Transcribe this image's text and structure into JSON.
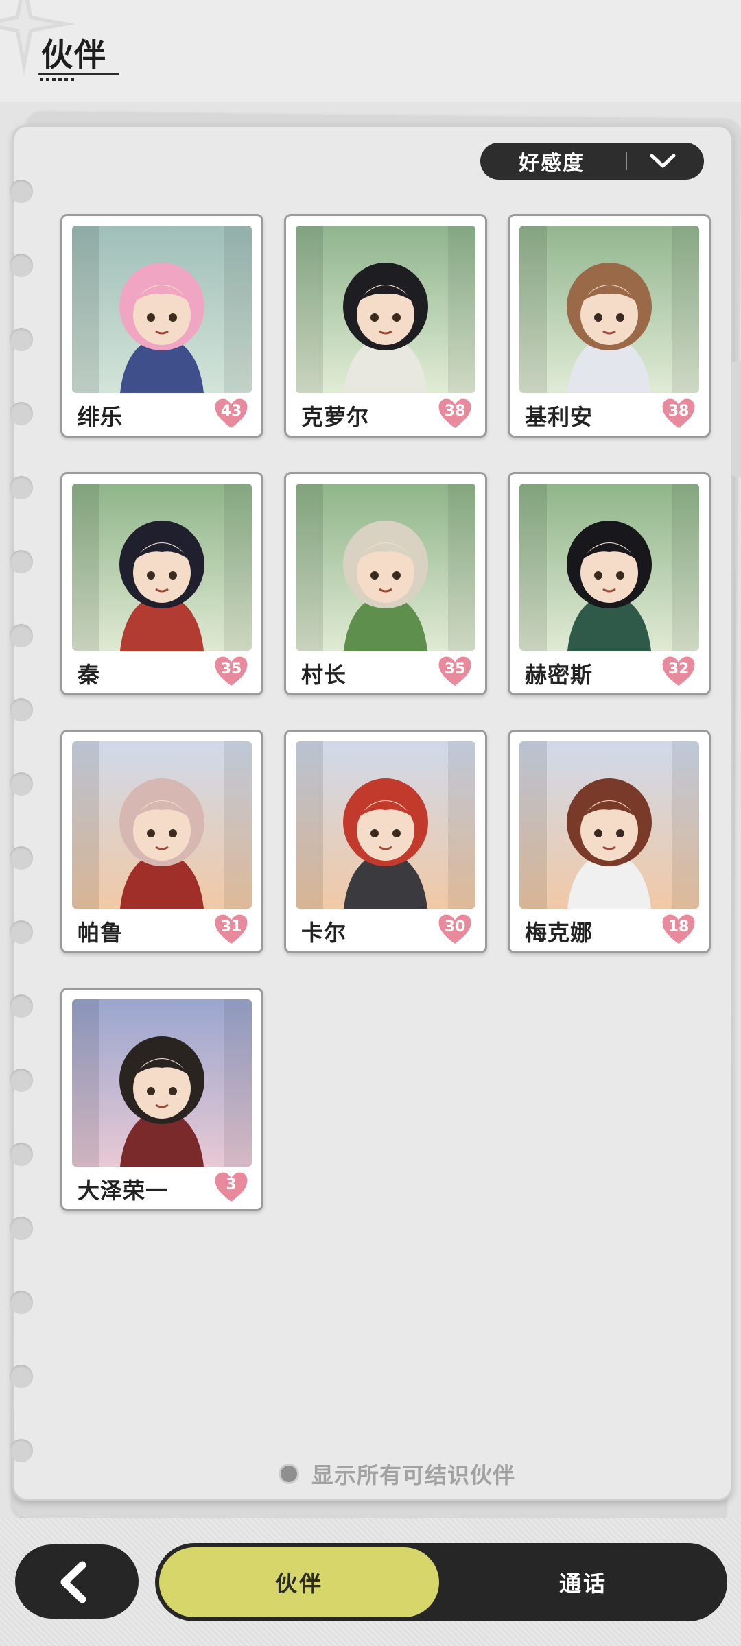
{
  "header": {
    "title": "伙伴"
  },
  "sort": {
    "label": "好感度",
    "icon": "chevron-down-icon"
  },
  "partners": [
    {
      "name": "绯乐",
      "affection": "43",
      "portrait": "pink-haired-girl-portrait",
      "bg_top": "#9fbfb8",
      "bg_bottom": "#d3e4d9",
      "hair": "#f0a6c2",
      "outfit": "#3f4f8c"
    },
    {
      "name": "克萝尔",
      "affection": "38",
      "portrait": "black-cat-witch-portrait",
      "bg_top": "#8fb58e",
      "bg_bottom": "#e1ecd5",
      "hair": "#1e1e22",
      "outfit": "#e8e8e0"
    },
    {
      "name": "基利安",
      "affection": "38",
      "portrait": "rabbit-eared-boy-portrait",
      "bg_top": "#93b68f",
      "bg_bottom": "#e0ebd6",
      "hair": "#9a6a48",
      "outfit": "#e4e6ee"
    },
    {
      "name": "秦",
      "affection": "35",
      "portrait": "horned-girl-portrait",
      "bg_top": "#8fb58a",
      "bg_bottom": "#dfe9d2",
      "hair": "#1f1f2e",
      "outfit": "#b23b32"
    },
    {
      "name": "村长",
      "affection": "35",
      "portrait": "village-chief-portrait",
      "bg_top": "#8fb58a",
      "bg_bottom": "#e0ead4",
      "hair": "#d9d2c2",
      "outfit": "#5f8f4c"
    },
    {
      "name": "赫密斯",
      "affection": "32",
      "portrait": "fox-eared-scholar-portrait",
      "bg_top": "#8fb58a",
      "bg_bottom": "#e0ead4",
      "hair": "#18181c",
      "outfit": "#2f5a4a"
    },
    {
      "name": "帕鲁",
      "affection": "31",
      "portrait": "horned-warrior-portrait",
      "bg_top": "#cfd9ea",
      "bg_bottom": "#f1c9a6",
      "hair": "#d7b7b2",
      "outfit": "#a02f2a"
    },
    {
      "name": "卡尔",
      "affection": "30",
      "portrait": "red-haired-hammer-portrait",
      "bg_top": "#cfd9ea",
      "bg_bottom": "#f1c9a6",
      "hair": "#c23a2c",
      "outfit": "#3b3b3f"
    },
    {
      "name": "梅克娜",
      "affection": "18",
      "portrait": "goggles-girl-portrait",
      "bg_top": "#cfd9ea",
      "bg_bottom": "#f1c9a6",
      "hair": "#7a3a2a",
      "outfit": "#f0f0f0"
    },
    {
      "name": "大泽荣一",
      "affection": "3",
      "portrait": "kimono-boy-portrait",
      "bg_top": "#9aa6cf",
      "bg_bottom": "#e8c9d4",
      "hair": "#2a2420",
      "outfit": "#7a2a2a"
    }
  ],
  "show_all": {
    "label": "显示所有可结识伙伴"
  },
  "bottom_nav": {
    "back_icon": "back-arrow-icon",
    "tabs": [
      "伙伴",
      "通话"
    ],
    "active_tab": "伙伴"
  },
  "colors": {
    "heart": "#e8899c",
    "active_tab": "#d6d66a",
    "dark": "#262626"
  }
}
